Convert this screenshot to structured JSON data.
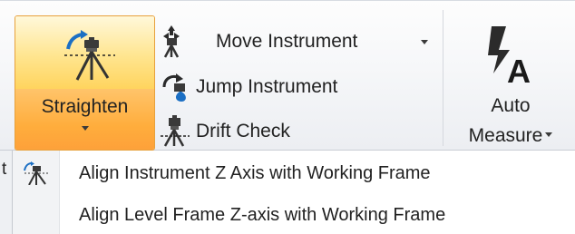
{
  "ribbon": {
    "straighten": {
      "label": "Straighten",
      "icon": "tripod-straighten-icon"
    },
    "move_instrument": {
      "label": "Move Instrument",
      "icon": "move-instrument-icon",
      "has_dropdown": true
    },
    "jump_instrument": {
      "label": "Jump Instrument",
      "icon": "jump-instrument-icon"
    },
    "drift_check": {
      "label": "Drift Check",
      "icon": "drift-check-icon"
    },
    "auto_measure": {
      "label_line1": "Auto",
      "label_line2": "Measure",
      "icon": "auto-measure-icon",
      "has_dropdown": true
    }
  },
  "left_stub_text": "t",
  "straighten_menu": {
    "items": [
      {
        "label": "Align Instrument Z Axis with Working Frame",
        "icon": "tripod-icon"
      },
      {
        "label": "Align Level Frame Z-axis with Working Frame",
        "icon": ""
      }
    ]
  },
  "colors": {
    "highlight_top": "#ffe58f",
    "highlight_bottom": "#ffad3c",
    "highlight_border": "#e7a13c",
    "icon_blue": "#1b6fc4"
  }
}
